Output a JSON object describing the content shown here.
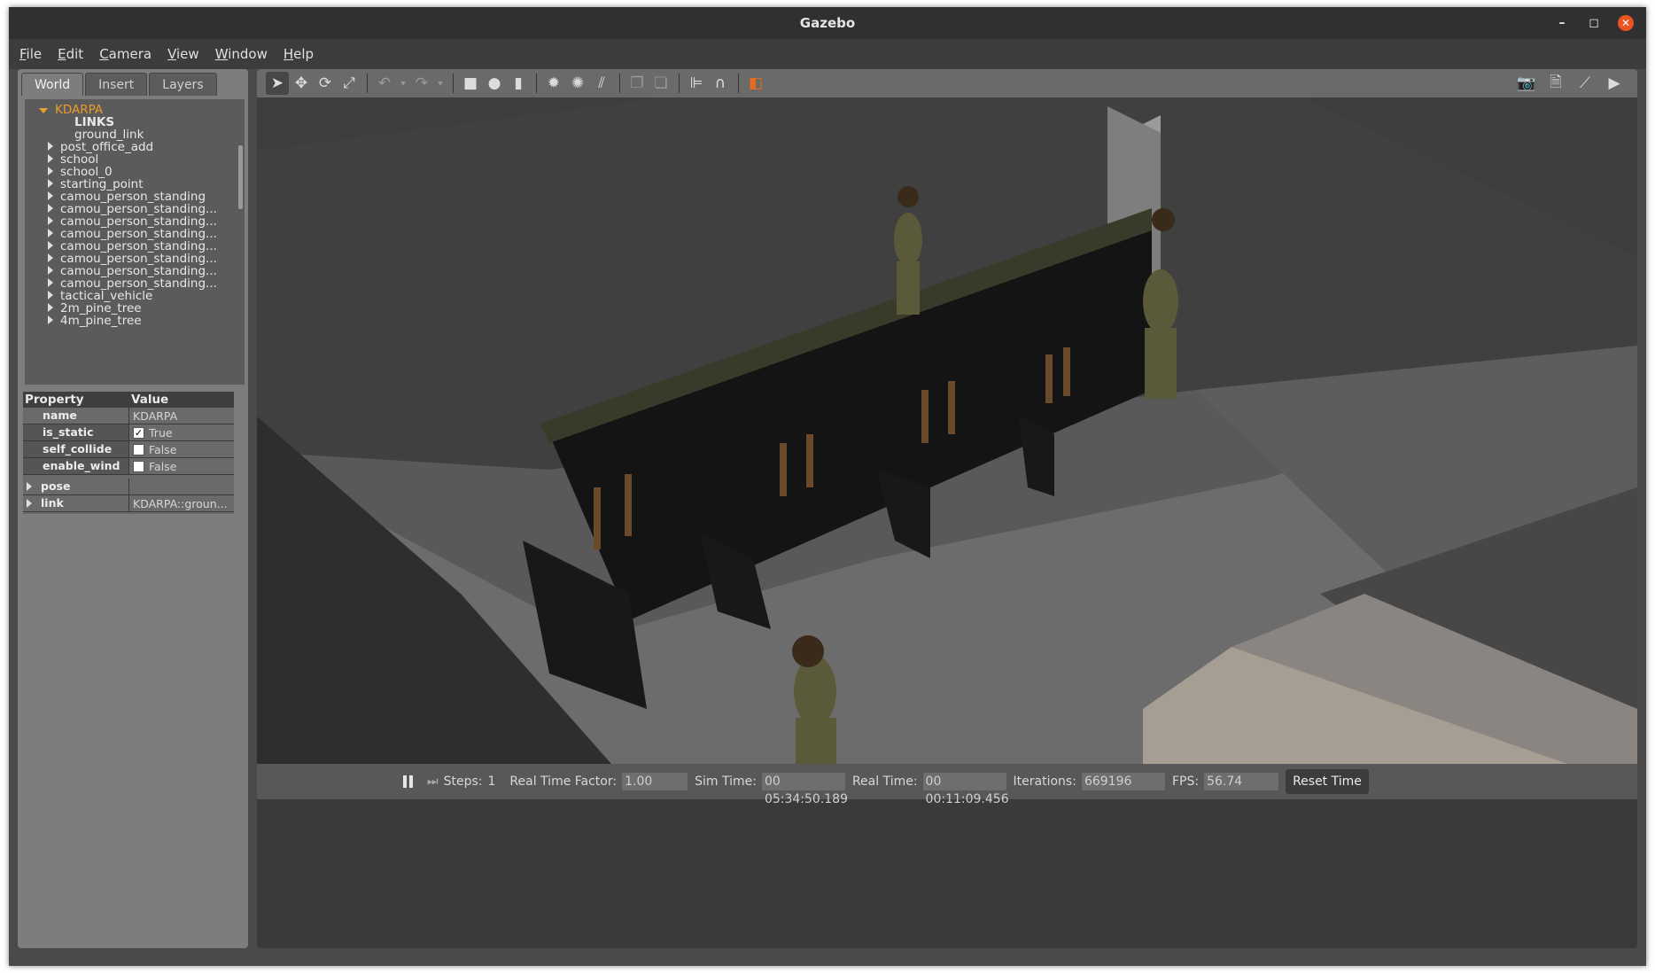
{
  "window": {
    "title": "Gazebo"
  },
  "menu": [
    "File",
    "Edit",
    "Camera",
    "View",
    "Window",
    "Help"
  ],
  "tabs": [
    "World",
    "Insert",
    "Layers"
  ],
  "tree": {
    "root": "KDARPA",
    "links_label": "LINKS",
    "link_item": "ground_link",
    "items": [
      "post_office_add",
      "school",
      "school_0",
      "starting_point",
      "camou_person_standing",
      "camou_person_standing...",
      "camou_person_standing...",
      "camou_person_standing...",
      "camou_person_standing...",
      "camou_person_standing...",
      "camou_person_standing...",
      "camou_person_standing...",
      "tactical_vehicle",
      "2m_pine_tree",
      "4m_pine_tree"
    ]
  },
  "properties": {
    "header": {
      "property": "Property",
      "value": "Value"
    },
    "name": {
      "key": "name",
      "value": "KDARPA"
    },
    "is_static": {
      "key": "is_static",
      "value": "True"
    },
    "self_collide": {
      "key": "self_collide",
      "value": "False"
    },
    "enable_wind": {
      "key": "enable_wind",
      "value": "False"
    },
    "pose": {
      "key": "pose"
    },
    "link": {
      "key": "link",
      "value": "KDARPA::groun..."
    }
  },
  "bottom": {
    "steps_label": "Steps:",
    "steps_value": "1",
    "rtf_label": "Real Time Factor:",
    "rtf_value": "1.00",
    "sim_label": "Sim Time:",
    "sim_value": "00 05:34:50.189",
    "real_label": "Real Time:",
    "real_value": "00 00:11:09.456",
    "iter_label": "Iterations:",
    "iter_value": "669196",
    "fps_label": "FPS:",
    "fps_value": "56.74",
    "reset_label": "Reset Time"
  }
}
